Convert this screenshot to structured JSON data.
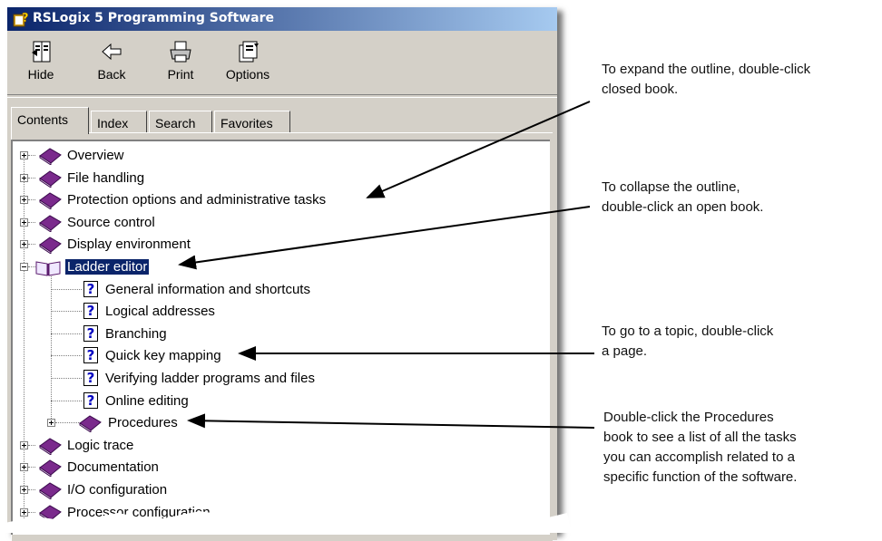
{
  "window": {
    "title": "RSLogix 5 Programming Software"
  },
  "toolbar": {
    "buttons": [
      {
        "label": "Hide",
        "icon": "hide-icon"
      },
      {
        "label": "Back",
        "icon": "back-arrow-icon"
      },
      {
        "label": "Print",
        "icon": "printer-icon"
      },
      {
        "label": "Options",
        "icon": "options-icon"
      }
    ]
  },
  "tabs": [
    {
      "label": "Contents",
      "active": true
    },
    {
      "label": "Index",
      "active": false
    },
    {
      "label": "Search",
      "active": false
    },
    {
      "label": "Favorites",
      "active": false
    }
  ],
  "tree": {
    "top_items_before": [
      "Overview",
      "File handling",
      "Protection options and administrative tasks",
      "Source control",
      "Display environment"
    ],
    "open_book": "Ladder editor",
    "pages": [
      "General information and shortcuts",
      "Logical addresses",
      "Branching",
      "Quick key mapping",
      "Verifying ladder programs and files",
      "Online editing"
    ],
    "sub_book": "Procedures",
    "top_items_after": [
      "Logic trace",
      "Documentation",
      "I/O configuration",
      "Processor configuration"
    ]
  },
  "annotations": [
    {
      "line1": "To expand the outline, double-click",
      "line2": "closed book."
    },
    {
      "line1": "To collapse the outline,",
      "line2": "double-click an open book."
    },
    {
      "line1": "To go to a topic, double-click",
      "line2": "a page."
    },
    {
      "line1": "Double-click the Procedures",
      "line2": "book to see a list of all the tasks",
      "line3": "you can accomplish related to a",
      "line4": "specific function of the software."
    }
  ],
  "colors": {
    "titlebar": "#0a246a",
    "book": "#7a2a8c",
    "selection": "#0a246a",
    "window_face": "#d4d0c8"
  }
}
